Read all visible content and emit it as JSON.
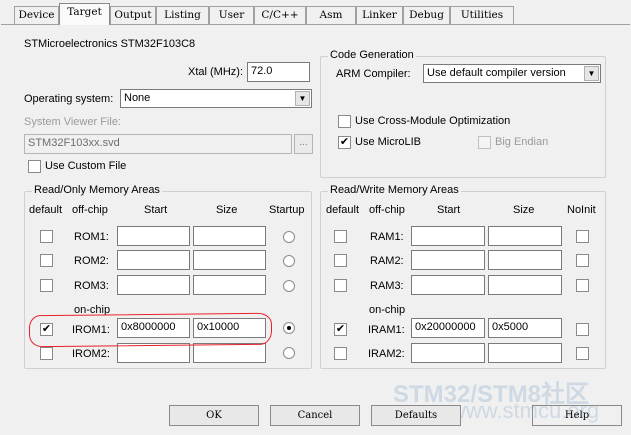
{
  "tabs": [
    {
      "label": "Device"
    },
    {
      "label": "Target"
    },
    {
      "label": "Output"
    },
    {
      "label": "Listing"
    },
    {
      "label": "User"
    },
    {
      "label": "C/C++"
    },
    {
      "label": "Asm"
    },
    {
      "label": "Linker"
    },
    {
      "label": "Debug"
    },
    {
      "label": "Utilities"
    }
  ],
  "active_tab": "Target",
  "device_name": "STMicroelectronics STM32F103C8",
  "xtal": {
    "label": "Xtal (MHz):",
    "value": "72.0"
  },
  "operating_system": {
    "label": "Operating system:",
    "value": "None"
  },
  "system_viewer": {
    "label": "System Viewer File:",
    "value": "STM32F103xx.svd",
    "browse": "..."
  },
  "use_custom_file": {
    "label": "Use Custom File",
    "checked": false
  },
  "code_generation": {
    "title": "Code Generation",
    "arm_compiler_label": "ARM Compiler:",
    "arm_compiler_value": "Use default compiler version",
    "cross_module": {
      "label": "Use Cross-Module Optimization",
      "checked": false
    },
    "microlib": {
      "label": "Use MicroLIB",
      "checked": true
    },
    "big_endian": {
      "label": "Big Endian",
      "checked": false
    }
  },
  "ro_memory": {
    "title": "Read/Only Memory Areas",
    "headers": {
      "default": "default",
      "offchip": "off-chip",
      "start": "Start",
      "size": "Size",
      "startup": "Startup"
    },
    "onchip_label": "on-chip",
    "rows": [
      {
        "label": "ROM1:",
        "start": "",
        "size": "",
        "default": false,
        "startup": false
      },
      {
        "label": "ROM2:",
        "start": "",
        "size": "",
        "default": false,
        "startup": false
      },
      {
        "label": "ROM3:",
        "start": "",
        "size": "",
        "default": false,
        "startup": false
      },
      {
        "label": "IROM1:",
        "start": "0x8000000",
        "size": "0x10000",
        "default": true,
        "startup": true
      },
      {
        "label": "IROM2:",
        "start": "",
        "size": "",
        "default": false,
        "startup": false
      }
    ]
  },
  "rw_memory": {
    "title": "Read/Write Memory Areas",
    "headers": {
      "default": "default",
      "offchip": "off-chip",
      "start": "Start",
      "size": "Size",
      "noinit": "NoInit"
    },
    "onchip_label": "on-chip",
    "rows": [
      {
        "label": "RAM1:",
        "start": "",
        "size": "",
        "default": false,
        "noinit": false
      },
      {
        "label": "RAM2:",
        "start": "",
        "size": "",
        "default": false,
        "noinit": false
      },
      {
        "label": "RAM3:",
        "start": "",
        "size": "",
        "default": false,
        "noinit": false
      },
      {
        "label": "IRAM1:",
        "start": "0x20000000",
        "size": "0x5000",
        "default": true,
        "noinit": false
      },
      {
        "label": "IRAM2:",
        "start": "",
        "size": "",
        "default": false,
        "noinit": false
      }
    ]
  },
  "buttons": {
    "ok": "OK",
    "cancel": "Cancel",
    "defaults": "Defaults",
    "help": "Help"
  },
  "watermark": {
    "line1": "STM32/STM8社区",
    "line2": "www.stmcu.org"
  },
  "colors": {
    "annotation": "#e8202a",
    "watermark": "#c9d6e2"
  }
}
